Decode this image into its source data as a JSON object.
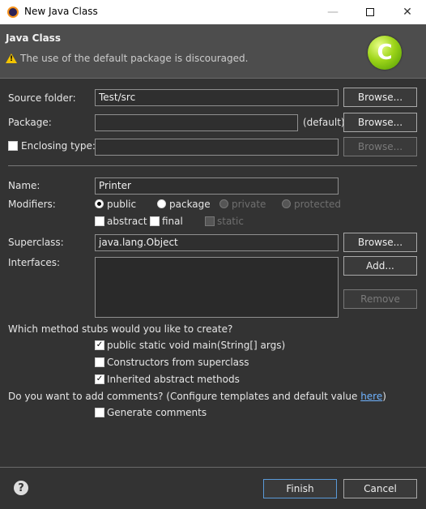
{
  "window": {
    "title": "New Java Class"
  },
  "header": {
    "title": "Java Class",
    "message": "The use of the default package is discouraged.",
    "icon_letter": "C"
  },
  "form": {
    "source_folder": {
      "label": "Source folder:",
      "value": "Test/src",
      "button": "Browse..."
    },
    "package": {
      "label": "Package:",
      "value": "",
      "suffix": "(default)",
      "button": "Browse..."
    },
    "enclosing_type": {
      "label": "Enclosing type:",
      "value": "",
      "button": "Browse...",
      "checked": false
    },
    "name": {
      "label": "Name:",
      "value": "Printer"
    },
    "modifiers": {
      "label": "Modifiers:",
      "public": "public",
      "package": "package",
      "private": "private",
      "protected": "protected",
      "abstract": "abstract",
      "final": "final",
      "static": "static",
      "selected": "public"
    },
    "superclass": {
      "label": "Superclass:",
      "value": "java.lang.Object",
      "button": "Browse..."
    },
    "interfaces": {
      "label": "Interfaces:",
      "add_button": "Add...",
      "remove_button": "Remove"
    }
  },
  "stubs": {
    "question": "Which method stubs would you like to create?",
    "main": {
      "label": "public static void main(String[] args)",
      "checked": true
    },
    "constructors": {
      "label": "Constructors from superclass",
      "checked": false
    },
    "inherited": {
      "label": "Inherited abstract methods",
      "checked": true
    }
  },
  "comments": {
    "question": "Do you want to add comments? (Configure templates and default value ",
    "link": "here",
    "close": ")",
    "generate": {
      "label": "Generate comments",
      "checked": false
    }
  },
  "footer": {
    "help": "?",
    "finish": "Finish",
    "cancel": "Cancel"
  },
  "colors": {
    "accent": "#5a9ad8",
    "warning": "#f2c300",
    "link": "#6fb3ff"
  }
}
